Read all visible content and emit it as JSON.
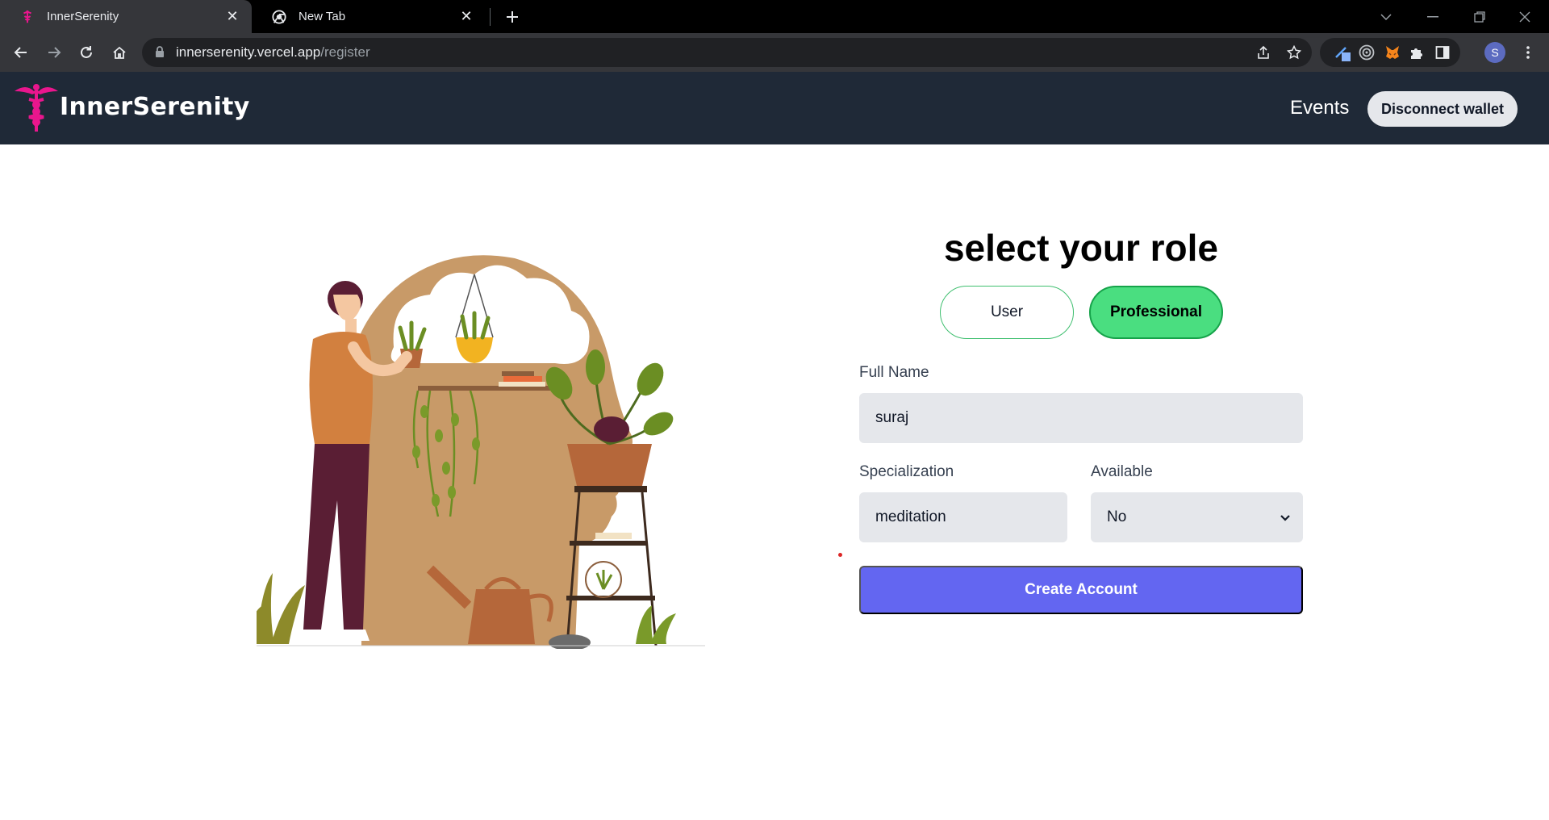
{
  "browser": {
    "tabs": [
      {
        "title": "InnerSerenity",
        "active": true,
        "icon": "caduceus-favicon"
      },
      {
        "title": "New Tab",
        "active": false,
        "icon": "chrome-icon"
      }
    ],
    "url_host": "innerserenity.vercel.app",
    "url_path": "/register",
    "profile_initial": "S"
  },
  "navbar": {
    "brand": "InnerSerenity",
    "events_link": "Events",
    "disconnect_label": "Disconnect wallet"
  },
  "form": {
    "title": "select your role",
    "roles": {
      "user": "User",
      "professional": "Professional",
      "selected": "Professional"
    },
    "full_name_label": "Full Name",
    "full_name_value": "suraj",
    "specialization_label": "Specialization",
    "specialization_value": "meditation",
    "available_label": "Available",
    "available_value": "No",
    "submit_label": "Create Account"
  },
  "colors": {
    "nav_bg": "#1f2937",
    "brand_pink": "#e9168d",
    "professional_green": "#4ade80",
    "submit_indigo": "#6366f1",
    "input_bg": "#e5e7eb"
  }
}
